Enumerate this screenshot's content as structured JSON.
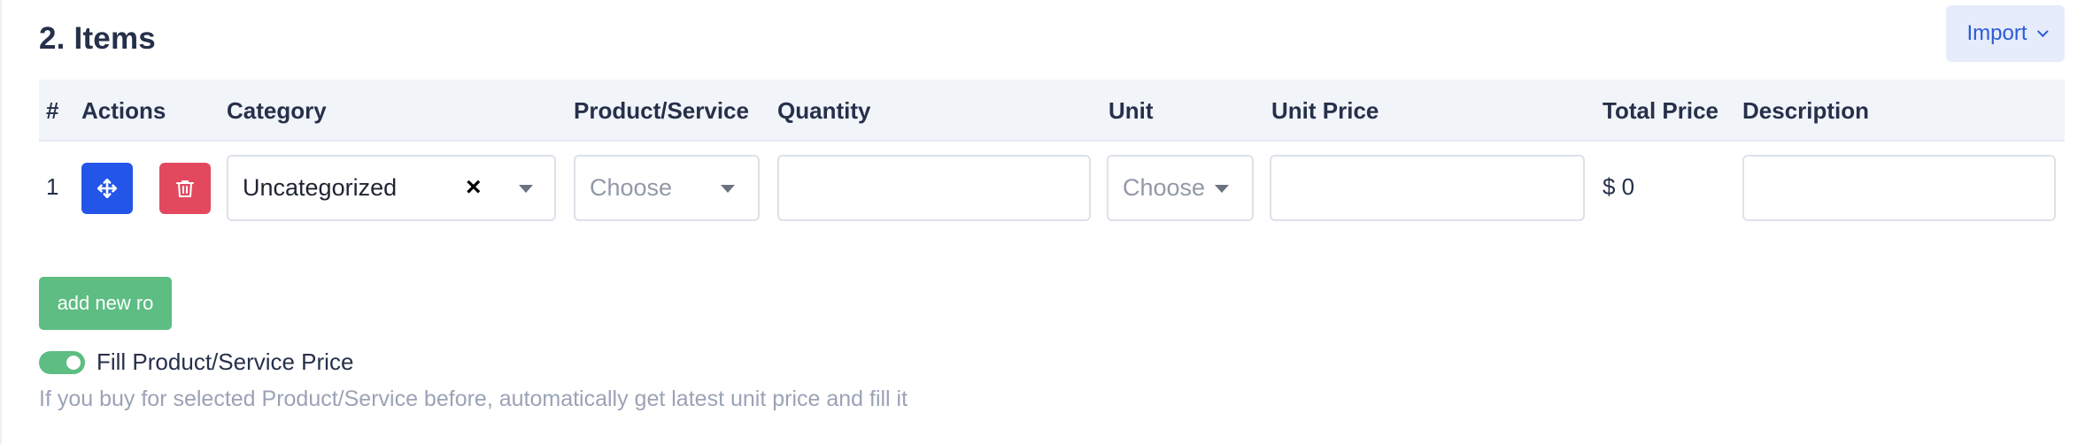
{
  "section": {
    "title": "2. Items",
    "import_label": "Import"
  },
  "table": {
    "headers": {
      "index": "#",
      "actions": "Actions",
      "category": "Category",
      "product": "Product/Service",
      "quantity": "Quantity",
      "unit": "Unit",
      "unit_price": "Unit Price",
      "total_price": "Total Price",
      "description": "Description"
    },
    "rows": [
      {
        "index": "1",
        "category": "Uncategorized",
        "product_placeholder": "Choose",
        "quantity": "",
        "unit_placeholder": "Choose",
        "unit_price": "",
        "total_price": "$ 0",
        "description": ""
      }
    ]
  },
  "add_row_label": "add new ro",
  "fill_price": {
    "label": "Fill Product/Service Price",
    "enabled": true,
    "help": "If you buy for selected Product/Service before, automatically get latest unit price and fill it"
  },
  "colors": {
    "primary": "#2255e8",
    "danger": "#e2495f",
    "success": "#5dbd83",
    "import_bg": "#e6ecfb"
  },
  "icons": {
    "move": "move-arrows-icon",
    "delete": "trash-icon",
    "import_caret": "chevron-down-icon",
    "clear": "close-icon",
    "dropdown": "caret-down-icon"
  }
}
